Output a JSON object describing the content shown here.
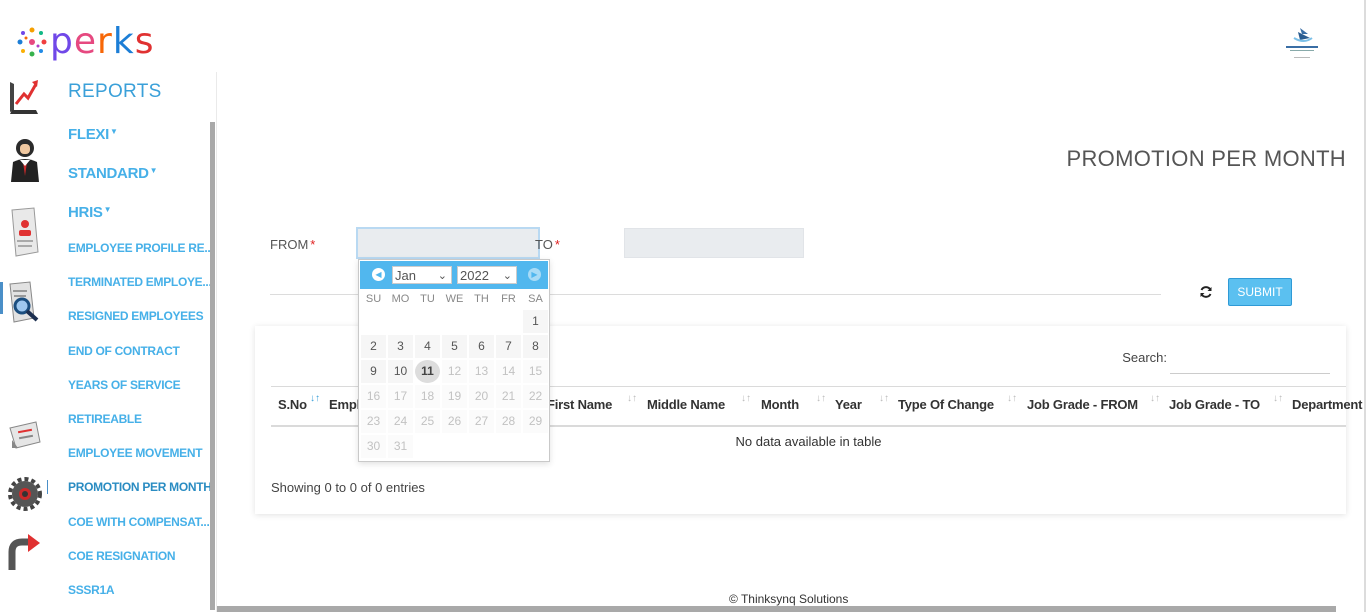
{
  "brand": {
    "logo_text": "perks"
  },
  "sidebar": {
    "title": "REPORTS",
    "groups": [
      {
        "label": "FLEXI"
      },
      {
        "label": "STANDARD"
      },
      {
        "label": "HRIS"
      }
    ],
    "items": [
      {
        "label": "EMPLOYEE PROFILE RE..."
      },
      {
        "label": "TERMINATED EMPLOYE..."
      },
      {
        "label": "RESIGNED EMPLOYEES"
      },
      {
        "label": "END OF CONTRACT"
      },
      {
        "label": "YEARS OF SERVICE"
      },
      {
        "label": "RETIREABLE"
      },
      {
        "label": "EMPLOYEE MOVEMENT"
      },
      {
        "label": "PROMOTION PER MONTH"
      },
      {
        "label": "COE WITH COMPENSAT..."
      },
      {
        "label": "COE RESIGNATION"
      },
      {
        "label": "SSSR1A"
      }
    ],
    "active_item": "PROMOTION PER MONTH"
  },
  "page": {
    "title": "PROMOTION PER MONTH"
  },
  "form": {
    "from_label": "FROM",
    "to_label": "TO",
    "required_mark": "*",
    "from_value": "",
    "to_value": "",
    "submit_label": "SUBMIT"
  },
  "datepicker": {
    "month": "Jan",
    "year": "2022",
    "weekdays": [
      "SU",
      "MO",
      "TU",
      "WE",
      "TH",
      "FR",
      "SA"
    ],
    "days": [
      "1",
      "2",
      "3",
      "4",
      "5",
      "6",
      "7",
      "8",
      "9",
      "10",
      "11",
      "12",
      "13",
      "14",
      "15",
      "16",
      "17",
      "18",
      "19",
      "20",
      "21",
      "22",
      "23",
      "24",
      "25",
      "26",
      "27",
      "28",
      "29",
      "30",
      "31"
    ],
    "today": "11",
    "selectable_through": "11"
  },
  "table": {
    "search_label": "Search:",
    "columns": [
      "S.No",
      "Empl...",
      "First Name",
      "Middle Name",
      "Month",
      "Year",
      "Type Of Change",
      "Job Grade - FROM",
      "Job Grade - TO",
      "Department"
    ],
    "empty_message": "No data available in table",
    "info": "Showing 0 to 0 of 0 entries"
  },
  "footer": {
    "text": "© Thinksynq Solutions"
  },
  "colors": {
    "accent": "#46b0e8",
    "header_blue": "#51b7ee",
    "required": "#e02020"
  }
}
